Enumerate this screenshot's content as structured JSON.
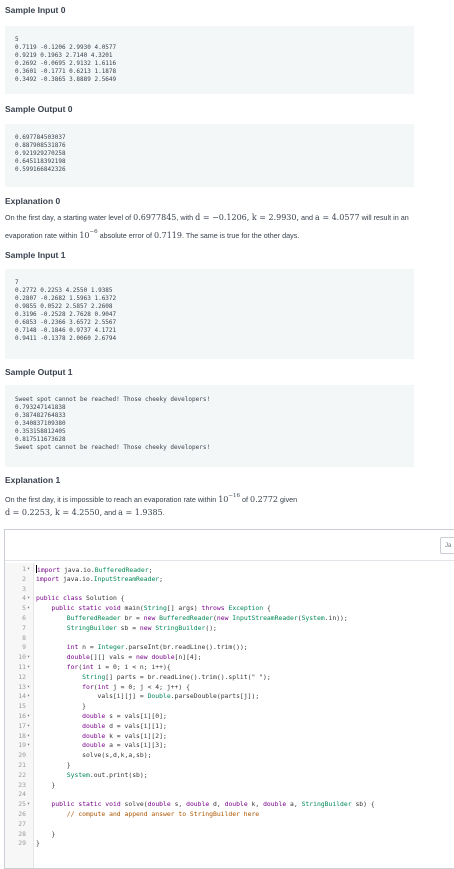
{
  "sample_input_0": {
    "title": "Sample Input 0",
    "lines": [
      "5",
      "0.7119 -0.1206 2.9930 4.0577",
      "0.9219 0.1963 2.7140 4.3201",
      "0.2692 -0.0695 2.9132 1.6116",
      "0.3601 -0.1771 0.6213 1.1878",
      "0.3492 -0.3865 3.8889 2.5649"
    ]
  },
  "sample_output_0": {
    "title": "Sample Output 0",
    "lines": [
      "0.697784503037",
      "0.887908531876",
      "0.921929270258",
      "0.645118392198",
      "0.599166842326"
    ]
  },
  "explanation_0": {
    "title": "Explanation 0",
    "t1": "On the first day, a starting water level of ",
    "m1": "0.6977845",
    "t2": ", with ",
    "m2": "d = −0.1206, k = 2.9930,",
    "t3": " and ",
    "m3": "a = 4.0577",
    "t4": " will result in an evaporation rate within ",
    "m4_base": "10",
    "m4_exp": "−6",
    "t5": " absolute error of ",
    "m5": "0.7119",
    "t6": ". The same is true for the other days."
  },
  "sample_input_1": {
    "title": "Sample Input 1",
    "lines": [
      "7",
      "0.2772 0.2253 4.2550 1.9385",
      "0.2807 -0.2682 1.5963 1.6372",
      "0.9855 0.0522 2.5857 2.2608",
      "0.3196 -0.2528 2.7628 0.9047",
      "0.6853 -0.2366 3.6572 2.5567",
      "0.7148 -0.1846 0.9737 4.1721",
      "0.9411 -0.1378 2.0060 2.6794"
    ]
  },
  "sample_output_1": {
    "title": "Sample Output 1",
    "lines": [
      "Sweet spot cannot be reached! Those cheeky developers!",
      "0.793247141838",
      "0.387482764833",
      "0.340837109380",
      "0.353158812405",
      "0.817511673628",
      "Sweet spot cannot be reached! Those cheeky developers!"
    ]
  },
  "explanation_1": {
    "title": "Explanation 1",
    "t1": "On the first day, it is impossible to reach an evaporation rate within ",
    "m1_base": "10",
    "m1_exp": "−16",
    "t2": " of ",
    "m2": "0.2772",
    "t3": " given",
    "m3": "d = 0.2253, k = 4.2550,",
    "t4": " and ",
    "m4": "a = 1.9385",
    "t5": "."
  },
  "editor": {
    "language_label": "Ja",
    "lines": [
      {
        "n": "1",
        "fold": "▾",
        "code": "import java.io.BufferedReader;"
      },
      {
        "n": "2",
        "fold": "",
        "code": "import java.io.InputStreamReader;"
      },
      {
        "n": "3",
        "fold": "",
        "code": ""
      },
      {
        "n": "4",
        "fold": "▾",
        "code": "public class Solution {"
      },
      {
        "n": "5",
        "fold": "▾",
        "code": "    public static void main(String[] args) throws Exception {"
      },
      {
        "n": "6",
        "fold": "",
        "code": "        BufferedReader br = new BufferedReader(new InputStreamReader(System.in));"
      },
      {
        "n": "7",
        "fold": "",
        "code": "        StringBuilder sb = new StringBuilder();"
      },
      {
        "n": "8",
        "fold": "",
        "code": ""
      },
      {
        "n": "9",
        "fold": "",
        "code": "        int n = Integer.parseInt(br.readLine().trim());"
      },
      {
        "n": "10",
        "fold": "▾",
        "code": "        double[][] vals = new double[n][4];"
      },
      {
        "n": "11",
        "fold": "▾",
        "code": "        for(int i = 0; i < n; i++){"
      },
      {
        "n": "12",
        "fold": "",
        "code": "            String[] parts = br.readLine().trim().split(\" \");"
      },
      {
        "n": "13",
        "fold": "▾",
        "code": "            for(int j = 0; j < 4; j++) {"
      },
      {
        "n": "14",
        "fold": "▾",
        "code": "                vals[i][j] = Double.parseDouble(parts[j]);"
      },
      {
        "n": "15",
        "fold": "",
        "code": "            }"
      },
      {
        "n": "16",
        "fold": "▾",
        "code": "            double s = vals[i][0];"
      },
      {
        "n": "17",
        "fold": "▾",
        "code": "            double d = vals[i][1];"
      },
      {
        "n": "18",
        "fold": "▾",
        "code": "            double k = vals[i][2];"
      },
      {
        "n": "19",
        "fold": "▾",
        "code": "            double a = vals[i][3];"
      },
      {
        "n": "20",
        "fold": "",
        "code": "            solve(s,d,k,a,sb);"
      },
      {
        "n": "21",
        "fold": "",
        "code": "        }"
      },
      {
        "n": "22",
        "fold": "",
        "code": "        System.out.print(sb);"
      },
      {
        "n": "23",
        "fold": "",
        "code": "    }"
      },
      {
        "n": "24",
        "fold": "",
        "code": ""
      },
      {
        "n": "25",
        "fold": "▾",
        "code": "    public static void solve(double s, double d, double k, double a, StringBuilder sb) {"
      },
      {
        "n": "26",
        "fold": "",
        "code": "        // compute and append answer to StringBuilder here"
      },
      {
        "n": "27",
        "fold": "",
        "code": ""
      },
      {
        "n": "28",
        "fold": "",
        "code": "    }"
      },
      {
        "n": "29",
        "fold": "",
        "code": "}"
      }
    ]
  }
}
